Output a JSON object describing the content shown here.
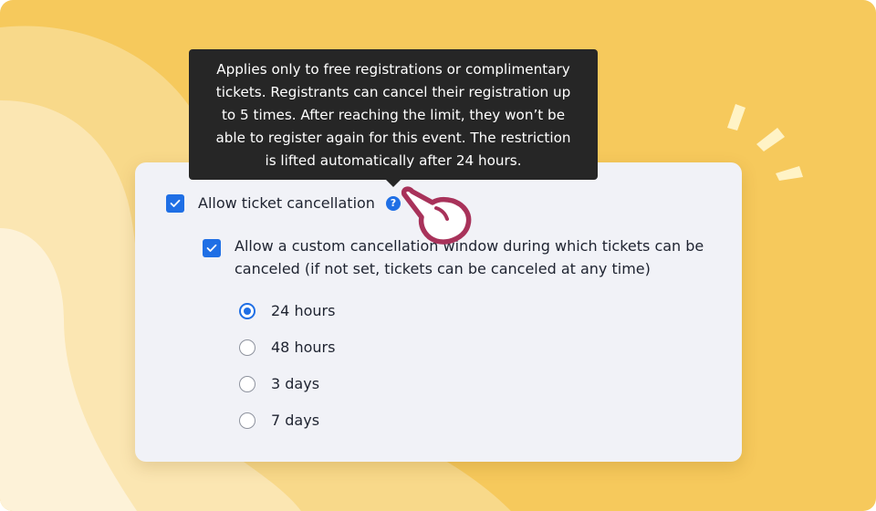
{
  "settings": {
    "allow_cancellation": {
      "label": "Allow ticket cancellation",
      "checked": true,
      "help_icon": "question-circle-icon"
    },
    "custom_window": {
      "label_line1": "Allow a custom cancellation window during which tickets can be",
      "label_line2": "canceled (if not set, tickets can be canceled at any time)",
      "checked": true
    },
    "window_options": [
      {
        "label": "24 hours",
        "selected": true
      },
      {
        "label": "48 hours",
        "selected": false
      },
      {
        "label": "3 days",
        "selected": false
      },
      {
        "label": "7 days",
        "selected": false
      }
    ]
  },
  "tooltip": {
    "lines": [
      "Applies only to free registrations or complimentary",
      "tickets. Registrants can cancel their registration up",
      "to 5 times. After reaching the limit, they won’t be",
      "able to register again for this event. The restriction",
      "is lifted automatically after 24 hours."
    ]
  },
  "colors": {
    "accent": "#1f6fe5",
    "background": "#f6c95c",
    "card": "#f1f2f7",
    "tooltip": "#262626",
    "pointer_hand": "#a8325a"
  },
  "icons": {
    "checkmark": "checkmark-icon",
    "pointer": "pointing-hand-icon",
    "sparkle": "sparkle-lines-icon"
  }
}
